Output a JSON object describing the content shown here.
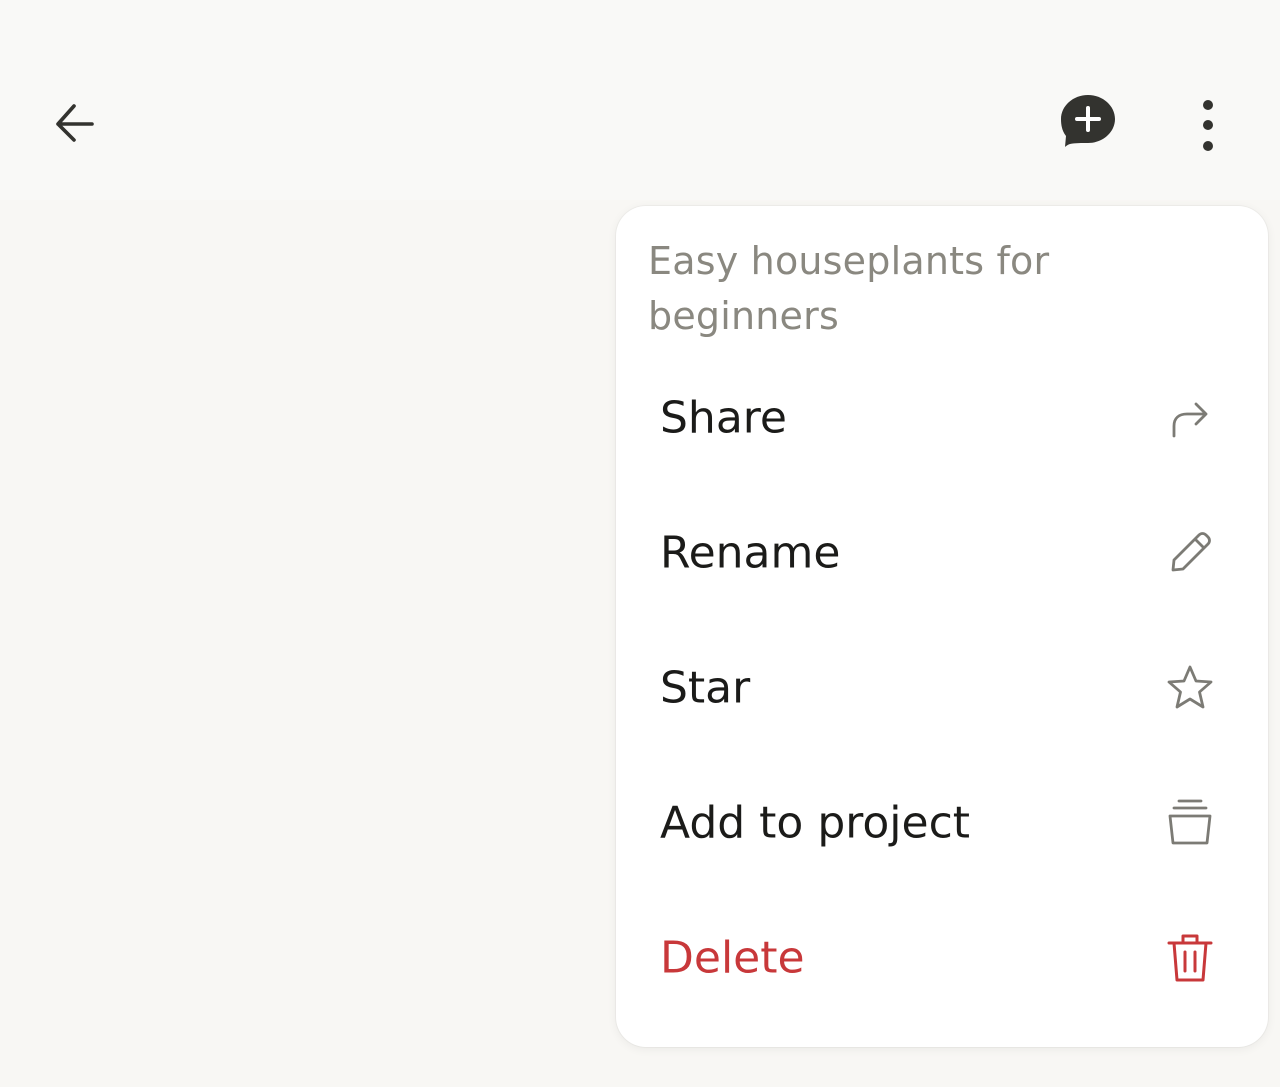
{
  "header": {
    "back_icon": "arrow-left-icon",
    "new_chat_icon": "chat-plus-icon",
    "more_icon": "vertical-dots-icon"
  },
  "menu": {
    "title": "Easy houseplants for beginners",
    "items": [
      {
        "label": "Share",
        "icon": "share-arrow-icon"
      },
      {
        "label": "Rename",
        "icon": "pencil-icon"
      },
      {
        "label": "Star",
        "icon": "star-icon"
      },
      {
        "label": "Add to project",
        "icon": "project-stack-icon"
      },
      {
        "label": "Delete",
        "icon": "trash-icon",
        "danger": true
      }
    ]
  },
  "colors": {
    "background": "#f8f7f4",
    "menu_background": "#ffffff",
    "title_text": "#8a8880",
    "item_text": "#1b1b19",
    "danger": "#c8383a",
    "icon": "#7c7b75",
    "header_icon": "#33332f"
  }
}
